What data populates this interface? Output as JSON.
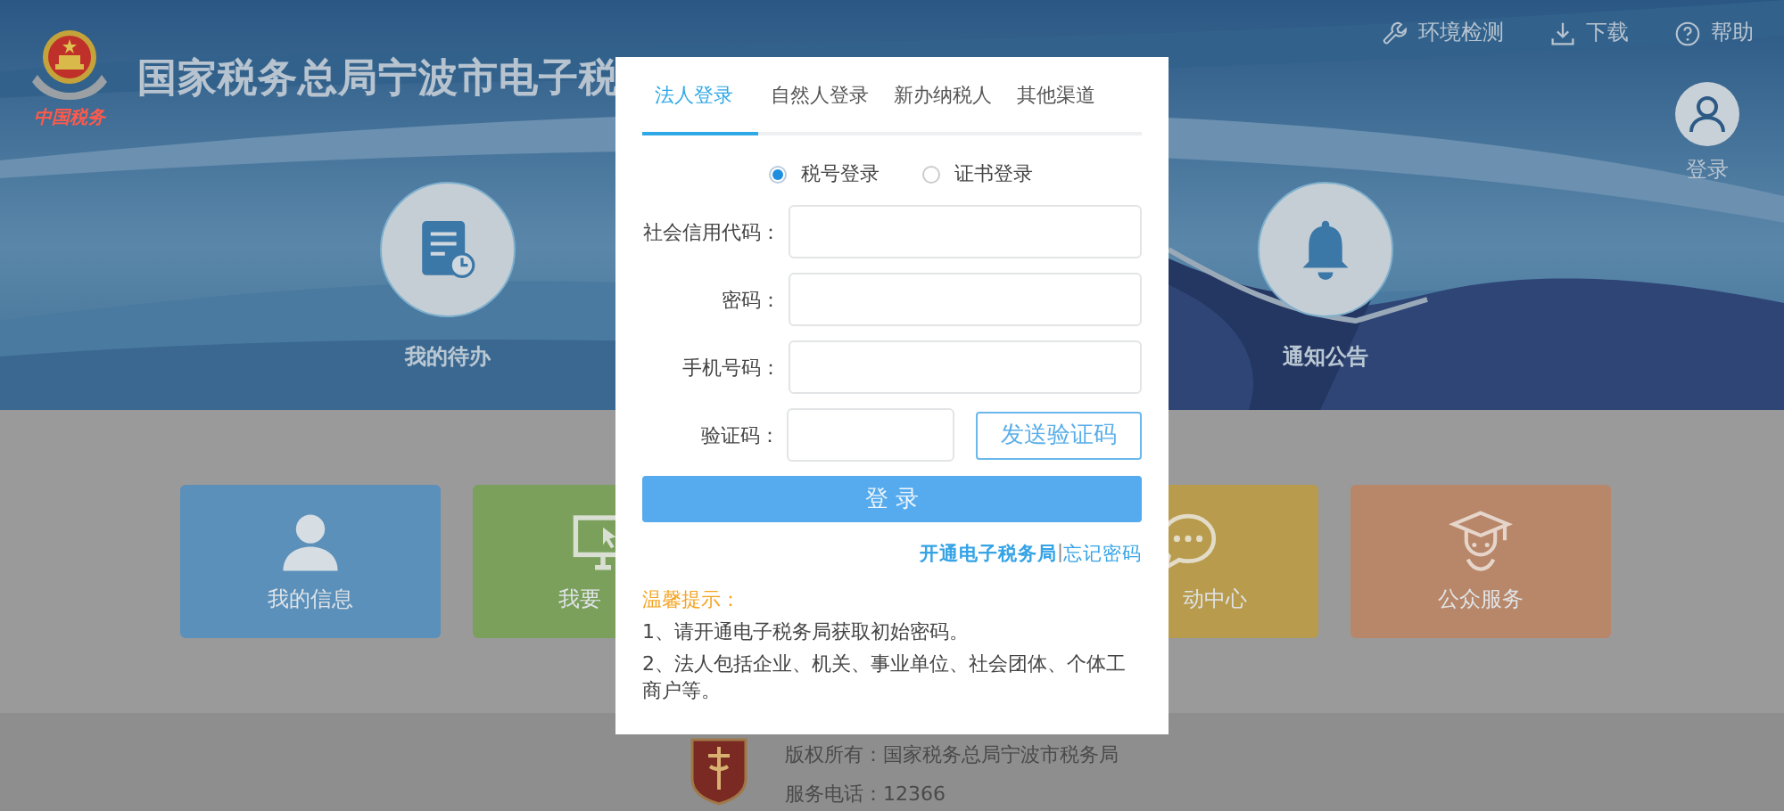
{
  "header": {
    "title": "国家税务总局宁波市电子税",
    "logo_caption": "中国税务"
  },
  "top_links": [
    {
      "label": "环境检测",
      "kind": "wrench"
    },
    {
      "label": "下载",
      "kind": "download"
    },
    {
      "label": "帮助",
      "kind": "help"
    }
  ],
  "user": {
    "label": "登录"
  },
  "banner_items": [
    {
      "label": "我的待办",
      "kind": "task"
    },
    {
      "label": "通知公告",
      "kind": "bell"
    }
  ],
  "tiles": [
    {
      "label": "我的信息",
      "kind": "person",
      "color": "#5b90bb"
    },
    {
      "label": "我要",
      "kind": "monitor",
      "color": "#7ba05c"
    },
    {
      "label": "动中心",
      "kind": "chat",
      "color": "#b89b4c"
    },
    {
      "label": "公众服务",
      "kind": "scholar",
      "color": "#b88668"
    }
  ],
  "footer": {
    "lines": [
      "版权所有：国家税务总局宁波市税务局",
      "服务电话：12366"
    ]
  },
  "dialog": {
    "tabs": [
      {
        "label": "法人登录",
        "selected": true
      },
      {
        "label": "自然人登录",
        "selected": false
      },
      {
        "label": "新办纳税人",
        "selected": false
      },
      {
        "label": "其他渠道",
        "selected": false
      }
    ],
    "login_modes": [
      {
        "label": "税号登录",
        "selected": true
      },
      {
        "label": "证书登录",
        "selected": false
      }
    ],
    "fields": [
      {
        "label": "社会信用代码：",
        "kind": "text"
      },
      {
        "label": "密码：",
        "kind": "text"
      },
      {
        "label": "手机号码：",
        "kind": "text"
      },
      {
        "label": "验证码：",
        "kind": "captcha",
        "button": "发送验证码"
      }
    ],
    "submit": "登 录",
    "links": [
      "开通电子税务局",
      "忘记密码"
    ],
    "link_separator": "|",
    "tips": {
      "title": "温馨提示：",
      "items": [
        "1、请开通电子税务局获取初始密码。",
        "2、法人包括企业、机关、事业单位、社会团体、个体工商户等。"
      ]
    }
  }
}
